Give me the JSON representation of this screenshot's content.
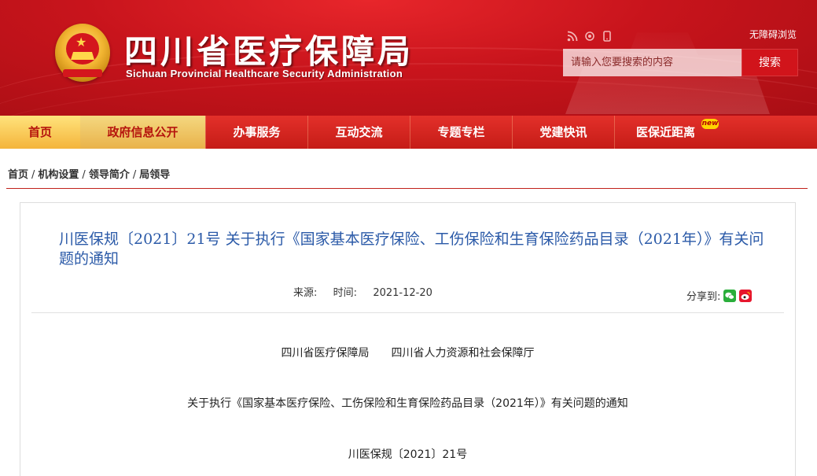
{
  "header": {
    "title": "四川省医疗保障局",
    "subtitle": "Sichuan Provincial Healthcare Security Administration",
    "accessible_link": "无障碍浏览",
    "search_placeholder": "请输入您要搜索的内容",
    "search_button": "搜索",
    "tool_icons": [
      "rss-icon",
      "settings-icon",
      "mobile-icon"
    ]
  },
  "nav": {
    "items": [
      "首页",
      "政府信息公开",
      "办事服务",
      "互动交流",
      "专题专栏",
      "党建快讯",
      "医保近距离"
    ],
    "badge": "new"
  },
  "breadcrumb": [
    "首页",
    "机构设置",
    "领导简介",
    "局领导"
  ],
  "article": {
    "title": "川医保规〔2021〕21号 关于执行《国家基本医疗保险、工伤保险和生育保险药品目录（2021年）》有关问题的通知",
    "source_label": "来源:",
    "time_label": "时间:",
    "time_value": "2021-12-20",
    "share_label": "分享到:",
    "share_icons": [
      "wechat-icon",
      "weibo-icon"
    ],
    "paragraphs": [
      "四川省医疗保障局　　四川省人力资源和社会保障厅",
      "关于执行《国家基本医疗保险、工伤保险和生育保险药品目录（2021年）》有关问题的通知",
      "川医保规〔2021〕21号"
    ]
  },
  "colors": {
    "brand_red": "#c8141c",
    "nav_gold": "#f4b43b",
    "title_blue": "#2b5aa8"
  }
}
